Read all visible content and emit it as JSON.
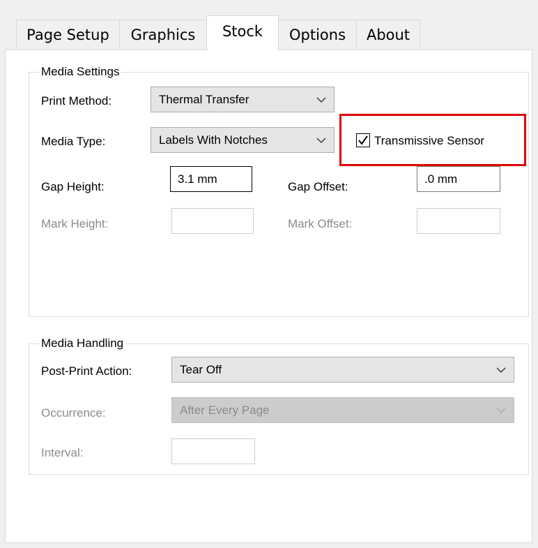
{
  "tabs": [
    {
      "label": "Page Setup"
    },
    {
      "label": "Graphics"
    },
    {
      "label": "Stock"
    },
    {
      "label": "Options"
    },
    {
      "label": "About"
    }
  ],
  "media_settings": {
    "title": "Media Settings",
    "print_method_label": "Print Method:",
    "print_method_value": "Thermal Transfer",
    "media_type_label": "Media Type:",
    "media_type_value": "Labels With Notches",
    "transmissive_sensor_label": "Transmissive Sensor",
    "transmissive_sensor_checked": true,
    "gap_height_label": "Gap Height:",
    "gap_height_value": "3.1 mm",
    "gap_offset_label": "Gap Offset:",
    "gap_offset_value": ".0 mm",
    "mark_height_label": "Mark Height:",
    "mark_height_value": "",
    "mark_offset_label": "Mark Offset:",
    "mark_offset_value": ""
  },
  "media_handling": {
    "title": "Media Handling",
    "post_print_action_label": "Post-Print Action:",
    "post_print_action_value": "Tear Off",
    "occurrence_label": "Occurrence:",
    "occurrence_value": "After Every Page",
    "interval_label": "Interval:",
    "interval_value": ""
  },
  "colors": {
    "highlight": "#e00000",
    "disabled_text": "#8a8a8a"
  }
}
